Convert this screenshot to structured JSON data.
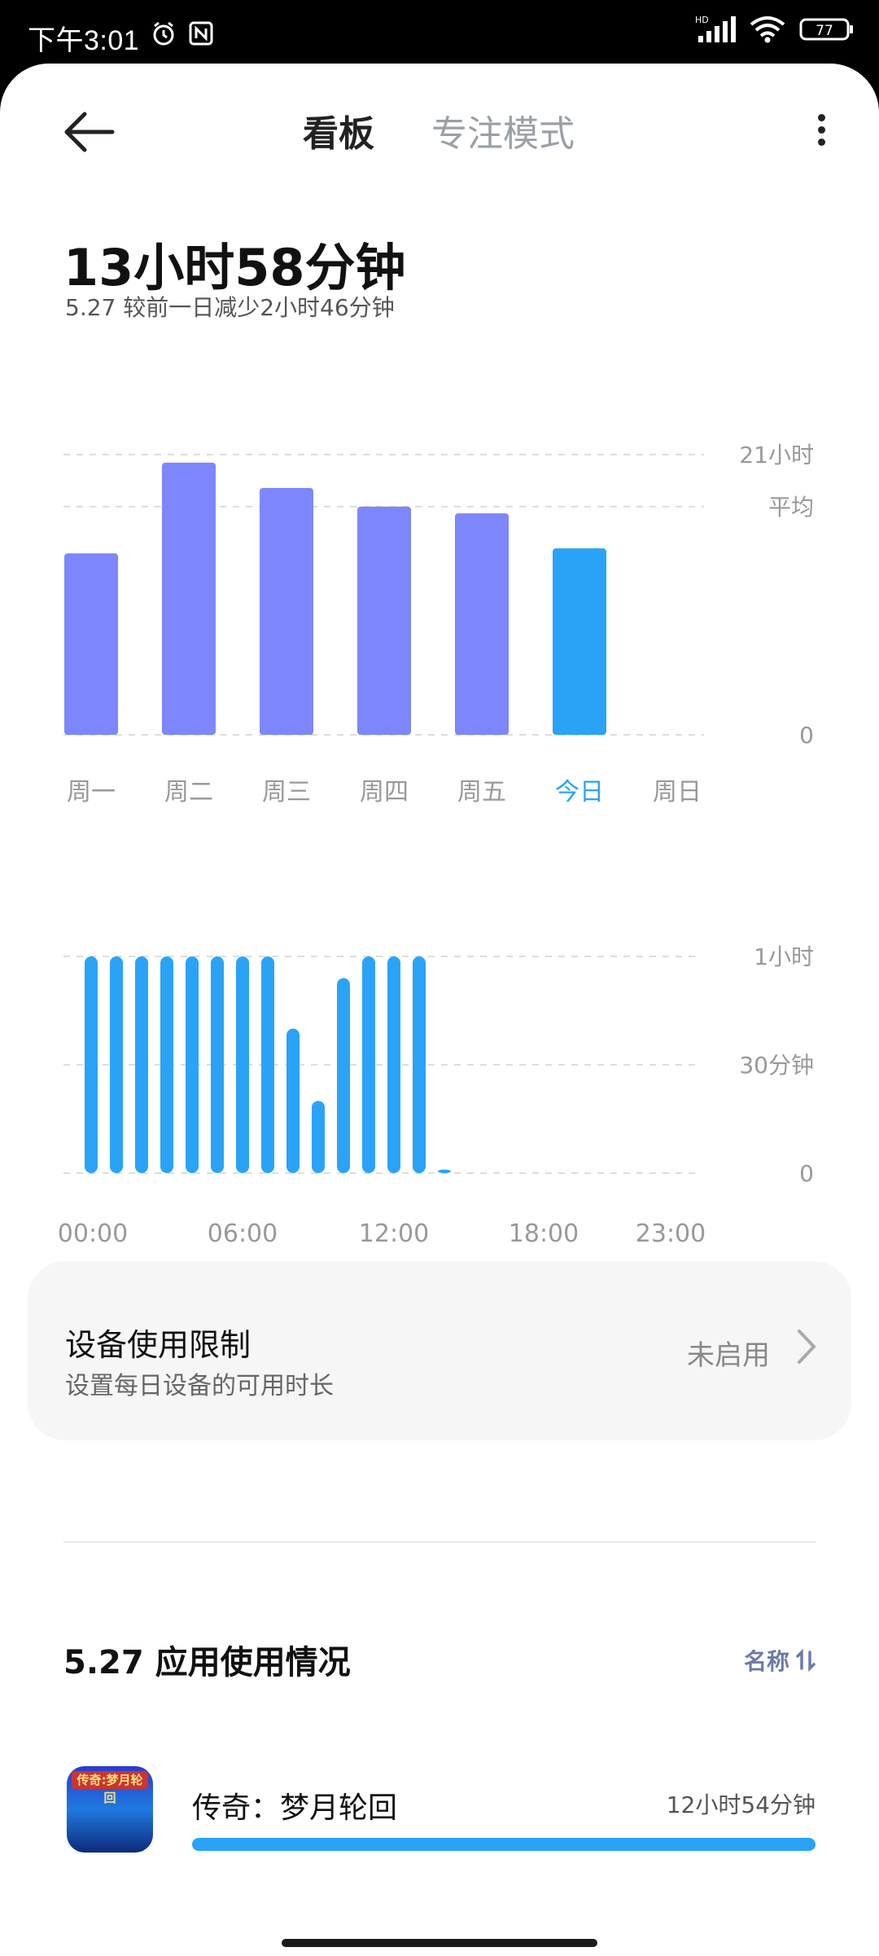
{
  "status_bar": {
    "time": "下午3:01",
    "network": "HD",
    "battery": "77"
  },
  "tabs": [
    {
      "label": "看板",
      "active": true
    },
    {
      "label": "专注模式",
      "active": false
    }
  ],
  "summary": {
    "total": "13小时58分钟",
    "compare": "5.27  较前一日减少2小时46分钟"
  },
  "chart_data": [
    {
      "type": "bar",
      "categories": [
        "周一",
        "周二",
        "周三",
        "周四",
        "周五",
        "今日",
        "周日"
      ],
      "values": [
        13.6,
        20.4,
        18.5,
        17.1,
        16.6,
        13.97,
        null
      ],
      "y_tick_labels": [
        "21小时",
        "平均",
        "0"
      ],
      "ylim": [
        0,
        21
      ],
      "average": 17.1,
      "highlight_category": "今日",
      "colors": {
        "bar": "#7d87fb",
        "today": "#2aa3f7",
        "grid": "#dddddd"
      }
    },
    {
      "type": "bar",
      "x_tick_labels": [
        "00:00",
        "06:00",
        "12:00",
        "18:00",
        "23:00"
      ],
      "y_tick_labels": [
        "1小时",
        "30分钟",
        "0"
      ],
      "ylim": [
        0,
        60
      ],
      "hours": [
        0,
        1,
        2,
        3,
        4,
        5,
        6,
        7,
        8,
        9,
        10,
        11,
        12,
        13,
        14
      ],
      "values_minutes": [
        60,
        60,
        60,
        60,
        60,
        60,
        60,
        60,
        40,
        20,
        54,
        60,
        60,
        60,
        1
      ],
      "colors": {
        "bar": "#2aa3f7"
      }
    }
  ],
  "limit_card": {
    "title": "设备使用限制",
    "subtitle": "设置每日设备的可用时长",
    "status": "未启用"
  },
  "usage": {
    "title": "5.27 应用使用情况",
    "sort_label": "名称",
    "apps": [
      {
        "name": "传奇：梦月轮回",
        "time": "12小时54分钟",
        "icon_text": "传奇:梦月轮回"
      }
    ]
  }
}
